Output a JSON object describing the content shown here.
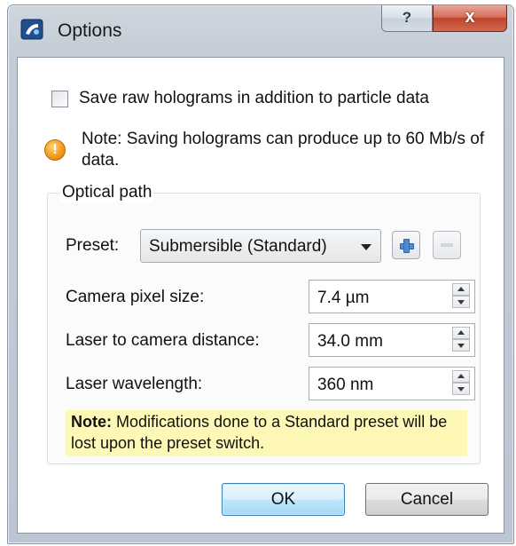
{
  "window": {
    "title": "Options",
    "help_glyph": "?",
    "close_glyph": "x",
    "app_icon": "app-icon"
  },
  "options": {
    "save_raw_label": "Save raw holograms in addition to particle data",
    "save_raw_checked": false,
    "note_icon": "warning-icon",
    "note_text": "Note: Saving holograms can produce up to 60 Mb/s of data."
  },
  "optical_path": {
    "group_title": "Optical path",
    "preset_label": "Preset:",
    "preset_value": "Submersible (Standard)",
    "add_icon": "plus-icon",
    "remove_icon": "minus-icon",
    "fields": [
      {
        "label": "Camera pixel size:",
        "value": "7.4 µm"
      },
      {
        "label": "Laser to camera distance:",
        "value": "34.0 mm"
      },
      {
        "label": "Laser wavelength:",
        "value": "360 nm"
      }
    ],
    "banner_bold": "Note:",
    "banner_text": " Modifications done to a Standard preset will be lost upon the preset switch."
  },
  "buttons": {
    "ok": "OK",
    "cancel": "Cancel"
  },
  "colors": {
    "banner_bg": "#fdf8b5",
    "warning": "#f09a1c",
    "close_button": "#c0432c"
  }
}
